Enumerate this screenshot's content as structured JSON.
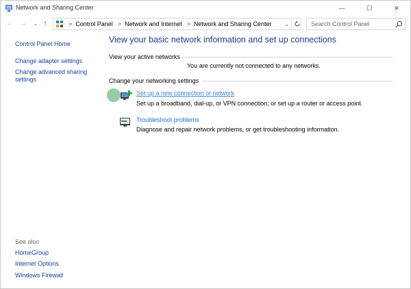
{
  "window": {
    "title": "Network and Sharing Center"
  },
  "controls": {
    "minimize": "—",
    "maximize": "☐",
    "close": "✕"
  },
  "nav": {
    "back": "←",
    "forward": "→",
    "recent": "⌄",
    "up": "↑"
  },
  "address": {
    "crumbs": [
      "Control Panel",
      "Network and Internet",
      "Network and Sharing Center"
    ],
    "separator": ">",
    "dropdown": "⌄"
  },
  "search": {
    "placeholder": "Search Control Panel"
  },
  "sidebar": {
    "home": "Control Panel Home",
    "links": [
      "Change adapter settings",
      "Change advanced sharing settings"
    ],
    "see_also_label": "See also",
    "see_also": [
      "HomeGroup",
      "Internet Options",
      "Windows Firewall"
    ]
  },
  "main": {
    "title": "View your basic network information and set up connections",
    "active_networks_heading": "View your active networks",
    "active_networks_status": "You are currently not connected to any networks.",
    "change_heading": "Change your networking settings",
    "tasks": [
      {
        "label": "Set up a new connection or network",
        "desc": "Set up a broadband, dial-up, or VPN connection; or set up a router or access point."
      },
      {
        "label": "Troubleshoot problems",
        "desc": "Diagnose and repair network problems, or get troubleshooting information."
      }
    ]
  },
  "colors": {
    "link": "#1a3d99",
    "task_link": "#1a6fc9",
    "title": "#1e3b8a"
  }
}
